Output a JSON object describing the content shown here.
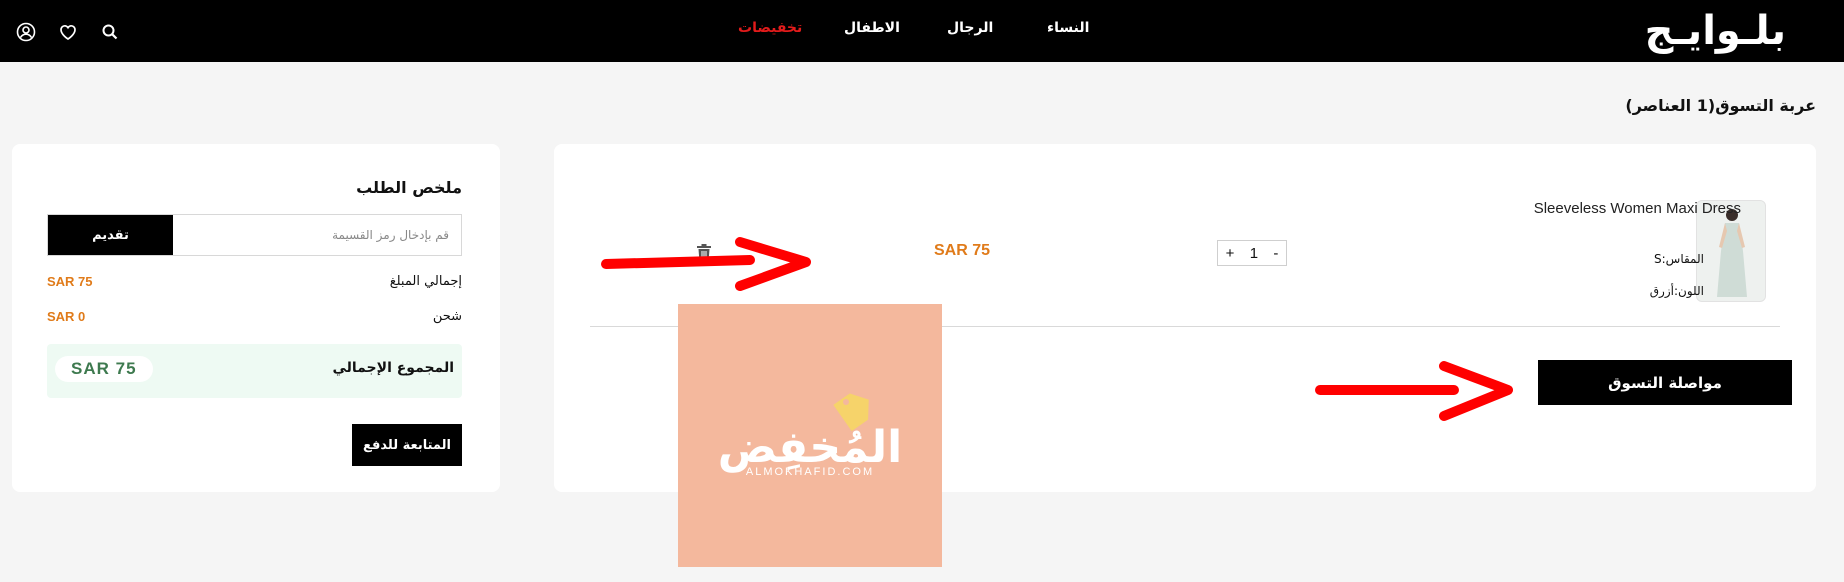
{
  "header": {
    "brand": "بلـوايـج",
    "nav": {
      "women": "النساء",
      "men": "الرجال",
      "kids": "الاطفال",
      "sale": "تخفيضات"
    },
    "icons": [
      "search-icon",
      "heart-icon",
      "user-icon"
    ]
  },
  "page": {
    "title": "عربة التسوق(1 العناصر)"
  },
  "cart": {
    "item": {
      "name": "Sleeveless Women Maxi Dress",
      "size": "المقاس:S",
      "color": "اللون:أزرق",
      "quantity": "1",
      "qty_minus": "-",
      "qty_plus": "+",
      "price": "SAR 75"
    },
    "continue_label": "مواصلة التسوق"
  },
  "summary": {
    "title": "ملخص الطلب",
    "coupon_placeholder": "قم بإدخال رمز القسيمة",
    "coupon_button": "تقديم",
    "subtotal_label": "إجمالي المبلغ",
    "subtotal_value": "SAR 75",
    "shipping_label": "شحن",
    "shipping_value": "SAR 0",
    "total_label": "المجموع الإجمالي",
    "total_value": "SAR 75",
    "checkout_label": "المتابعة للدفع"
  },
  "watermark": {
    "title": "المُخفِض",
    "url": "ALMOKHAFID.COM"
  },
  "colors": {
    "accent_price": "#e07b1a",
    "sale": "#e31b1b",
    "annotation_arrow": "#ff0000",
    "total_bg": "#eefaf3"
  }
}
